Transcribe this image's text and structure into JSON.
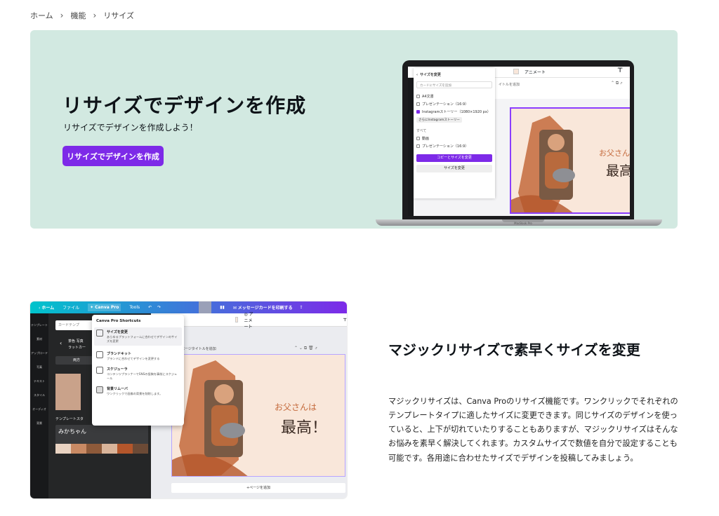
{
  "breadcrumb": {
    "home": "ホーム",
    "features": "機能",
    "current": "リサイズ"
  },
  "hero": {
    "title": "リサイズでデザインを作成",
    "subtitle": "リサイズでデザインを作成しよう！",
    "cta": "リサイズでデザインを作成"
  },
  "laptop": {
    "brand": "MacBook Pro",
    "panel_title": "サイズを変更",
    "search_placeholder": "カードにサイズを追加",
    "options": [
      "A4文書",
      "プレゼンテーション（16:9）",
      "Instagramストーリー（1080×1920 px）"
    ],
    "tag": "さらにInstagramストーリー",
    "section_label": "すべて",
    "options2": [
      "動画",
      "プレゼンテーション（16:9）"
    ],
    "copy_button": "コピーとサイズを変更",
    "resize_button": "サイズを変更",
    "animate": "アニメート",
    "card_text_1": "お父さんは",
    "card_text_2": "最高！"
  },
  "editor": {
    "topbar": [
      "ホーム",
      "ファイル",
      "Canva Pro",
      "Tools",
      "メッセージカードを印刷する"
    ],
    "rail": [
      "テンプレート",
      "素材",
      "アップロード",
      "写真",
      "テキスト",
      "スタイル",
      "オーディオ",
      "背景"
    ],
    "search_placeholder": "カードテンプ",
    "side_labels": [
      "茶色 写真",
      "ラットカー",
      "両方",
      "テンプレートスタ",
      "みかちゃん"
    ],
    "menu_title": "Canva Pro Shortcuts",
    "menu_items": [
      {
        "title": "サイズを変更",
        "desc": "あらゆるプラットフォームに合わせてデザインのサイズを変更"
      },
      {
        "title": "ブランドキット",
        "desc": "ブランドに合わせてデザインを変更する"
      },
      {
        "title": "スケジューラ",
        "desc": "コンテンツプランナーでSNSの投稿を事前にスケジュール"
      },
      {
        "title": "背景リムーバ",
        "desc": "ワンクリックで画像の背景を削除します。"
      }
    ],
    "animate": "アニメート",
    "page_label": "ジ - ページタイトルを追加",
    "add_page": "+ページを追加",
    "card_text_1": "お父さんは",
    "card_text_2": "最高！"
  },
  "section2": {
    "title": "マジックリサイズで素早くサイズを変更",
    "body": "マジックリサイズは、Canva Proのリサイズ機能です。ワンクリックでそれぞれのテンプレートタイプに適したサイズに変更できます。同じサイズのデザインを使っていると、上下が切れていたりすることもありますが、マジックリサイズはそんなお悩みを素早く解決してくれます。カスタムサイズで数値を自分で設定することも可能です。各用途に合わせたサイズでデザインを投稿してみましょう。"
  },
  "colors": {
    "accent": "#7d2ae8",
    "hero_bg": "#d2e9e1",
    "card_bg": "#f9e7da",
    "brush": "#c46a3c"
  }
}
